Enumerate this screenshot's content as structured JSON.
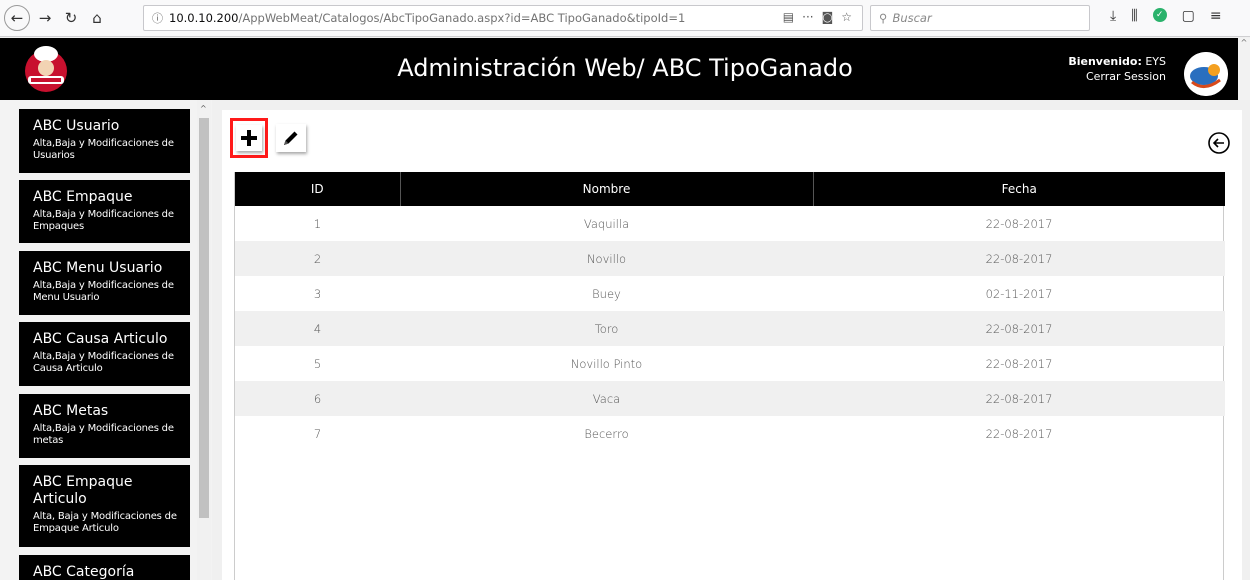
{
  "browser": {
    "url_host": "10.0.10.200",
    "url_path": "/AppWebMeat/Catalogos/AbcTipoGanado.aspx?id=ABC TipoGanado&tipoId=1",
    "search_placeholder": "Buscar"
  },
  "header": {
    "title": "Administración Web/ ABC TipoGanado",
    "welcome_label": "Bienvenido:",
    "user": "EYS",
    "logout": "Cerrar Session"
  },
  "sidebar": {
    "items": [
      {
        "title": "ABC Usuario",
        "desc": "Alta,Baja y Modificaciones de Usuarios"
      },
      {
        "title": "ABC Empaque",
        "desc": "Alta,Baja y Modificaciones de Empaques"
      },
      {
        "title": "ABC Menu Usuario",
        "desc": "Alta,Baja y Modificaciones de Menu Usuario"
      },
      {
        "title": "ABC Causa Articulo",
        "desc": "Alta,Baja y Modificaciones de Causa Articulo"
      },
      {
        "title": "ABC Metas",
        "desc": "Alta,Baja y Modificaciones de metas"
      },
      {
        "title": "ABC Empaque Articulo",
        "desc": "Alta, Baja y Modificaciones de Empaque Articulo"
      },
      {
        "title": "ABC Categoría",
        "desc": ""
      }
    ]
  },
  "table": {
    "headers": [
      "ID",
      "Nombre",
      "Fecha"
    ],
    "rows": [
      [
        "1",
        "Vaquilla",
        "22-08-2017"
      ],
      [
        "2",
        "Novillo",
        "22-08-2017"
      ],
      [
        "3",
        "Buey",
        "02-11-2017"
      ],
      [
        "4",
        "Toro",
        "22-08-2017"
      ],
      [
        "5",
        "Novillo Pinto",
        "22-08-2017"
      ],
      [
        "6",
        "Vaca",
        "22-08-2017"
      ],
      [
        "7",
        "Becerro",
        "22-08-2017"
      ]
    ]
  },
  "colors": {
    "header_bg": "#000000",
    "highlight": "#ff1a1a",
    "row_alt": "#f0f0f0"
  },
  "icons": {
    "add": "plus-icon",
    "edit": "pencil-icon",
    "back": "circle-arrow-left-icon"
  }
}
